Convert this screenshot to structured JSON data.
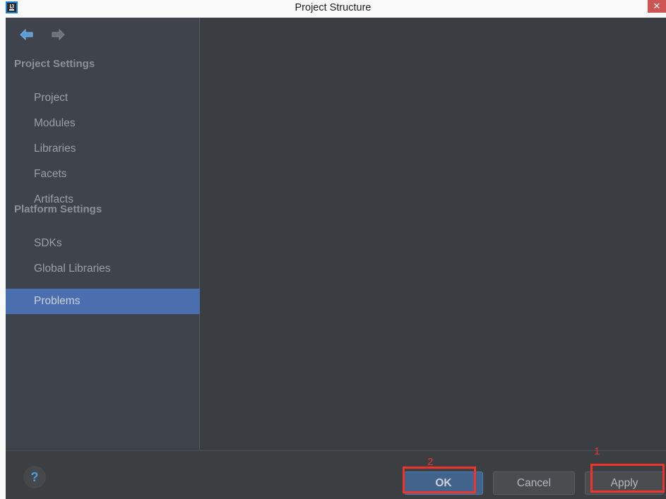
{
  "window": {
    "title": "Project Structure",
    "app_icon_name": "intellij-idea-icon",
    "app_icon_label": "IJ",
    "close_label": "✕"
  },
  "toolbar": {
    "back_icon": "arrow-left-icon",
    "back_glyph": "⬅",
    "forward_icon": "arrow-right-icon",
    "forward_glyph": "➡"
  },
  "sidebar": {
    "sections": [
      {
        "label": "Project Settings"
      },
      {
        "label": "Platform Settings"
      }
    ],
    "items": [
      {
        "label": "Project",
        "selected": false
      },
      {
        "label": "Modules",
        "selected": false
      },
      {
        "label": "Libraries",
        "selected": false
      },
      {
        "label": "Facets",
        "selected": false
      },
      {
        "label": "Artifacts",
        "selected": false
      },
      {
        "label": "SDKs",
        "selected": false
      },
      {
        "label": "Global Libraries",
        "selected": false
      },
      {
        "label": "Problems",
        "selected": true
      }
    ]
  },
  "footer": {
    "help_icon": "question-mark-icon",
    "help_label": "?",
    "ok_label": "OK",
    "cancel_label": "Cancel",
    "apply_label": "Apply"
  },
  "annotations": [
    {
      "label": "1",
      "target": "Apply"
    },
    {
      "label": "2",
      "target": "OK"
    }
  ],
  "colors": {
    "titlebar_bg": "#f9f9f9",
    "dialog_bg": "#3c3f41",
    "sidebar_bg": "#3f434c",
    "content_bg": "#3a3d42",
    "selection_blue": "#4b6eaf",
    "ok_button_blue": "#41638c",
    "accent_blue": "#4d9fe0",
    "annotation_red": "#f1332e",
    "close_red": "#cf5555",
    "text_muted": "#9aa0a6"
  }
}
